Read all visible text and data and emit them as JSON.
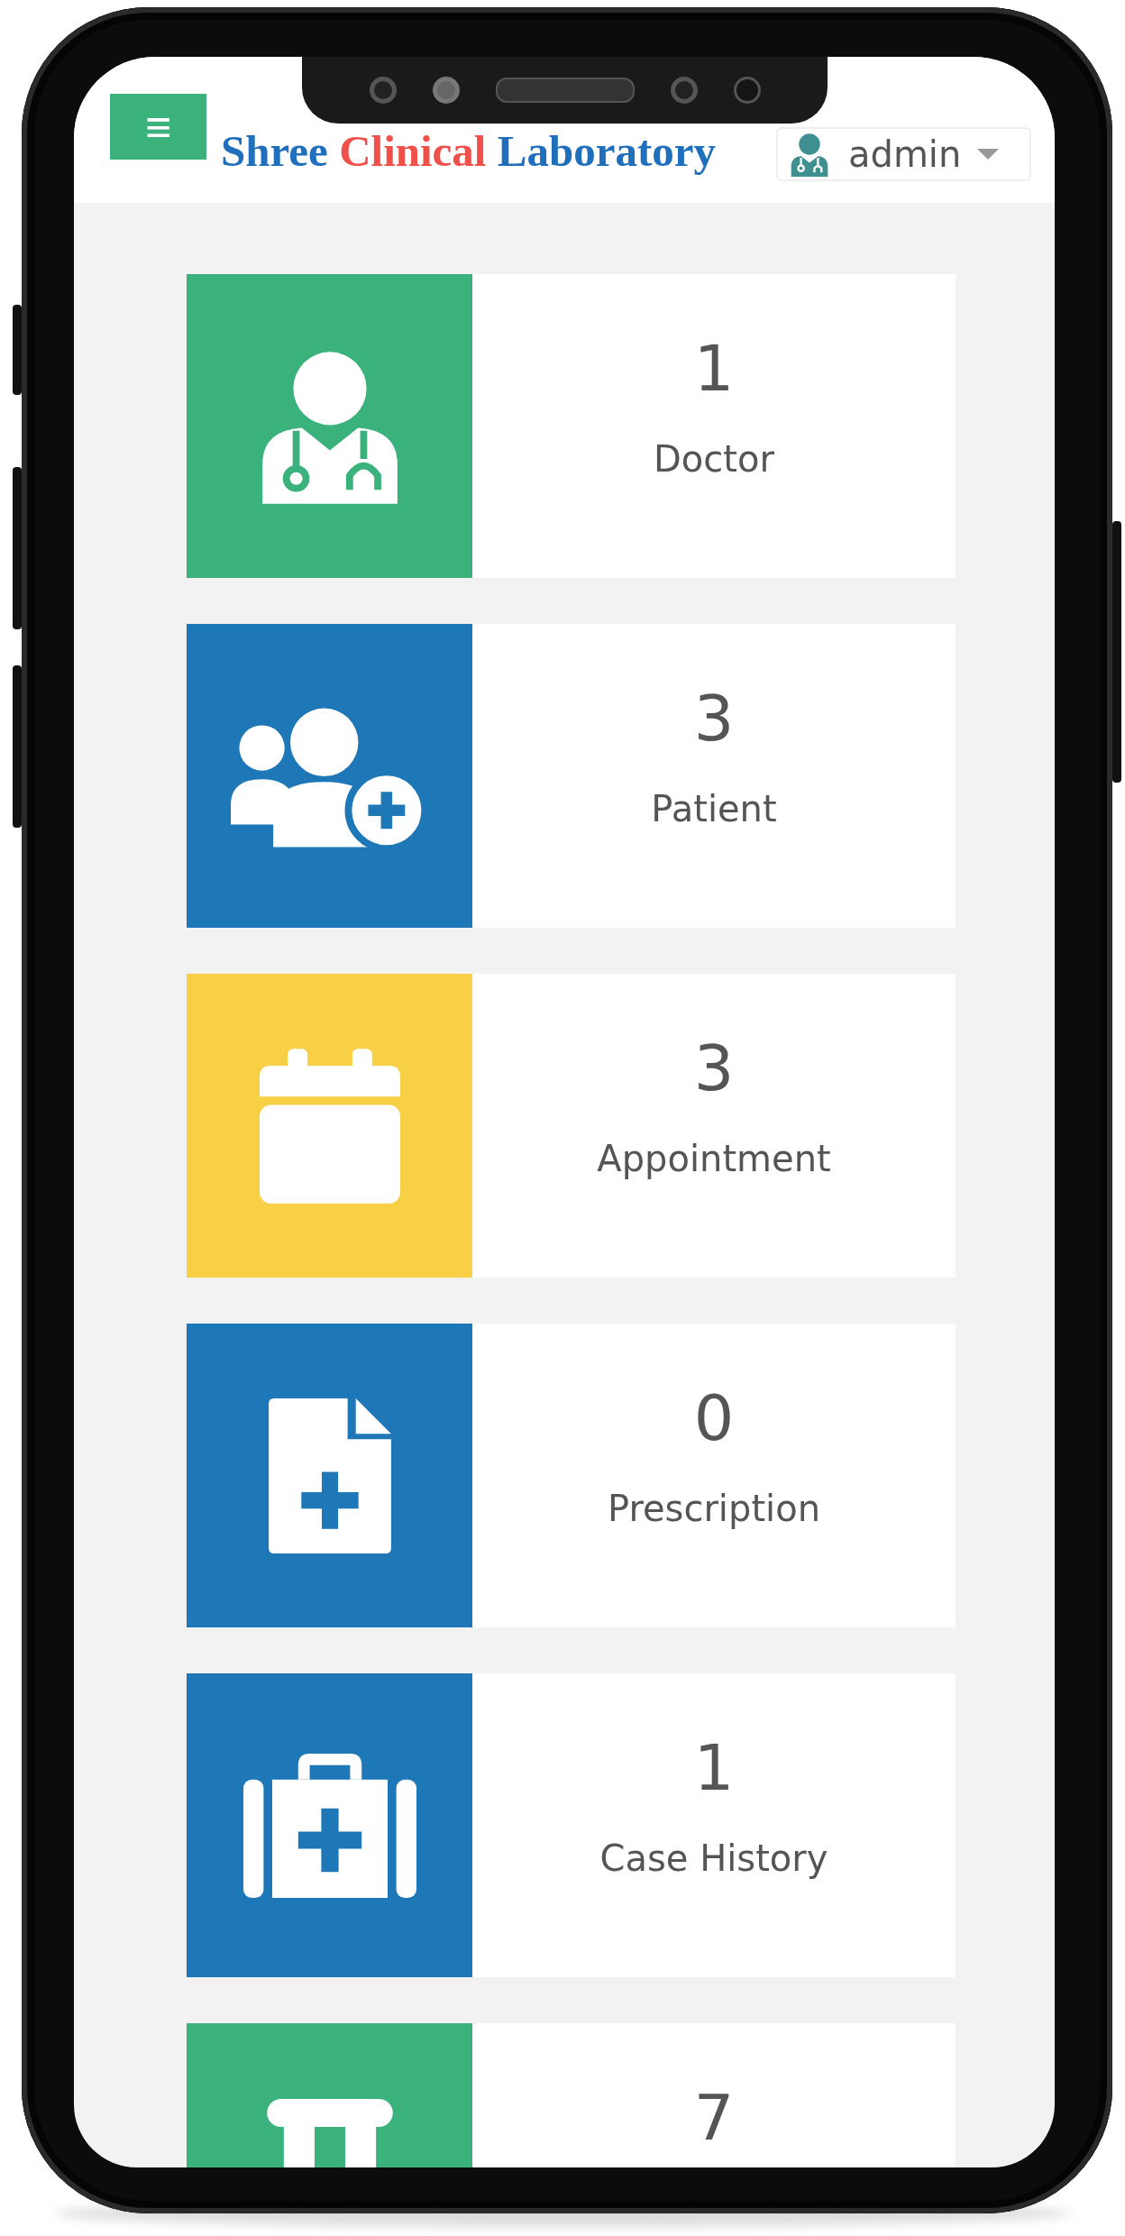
{
  "header": {
    "menu_icon": "≡",
    "title": [
      {
        "text": "Shree",
        "color": "#1f6fbd"
      },
      {
        "text": "Clinical",
        "color": "#f0504a"
      },
      {
        "text": "Laboratory",
        "color": "#1f6fbd"
      }
    ],
    "user": {
      "name": "admin"
    }
  },
  "cards": [
    {
      "count": "1",
      "label": "Doctor",
      "color": "#3bb27b",
      "kind": "doctor"
    },
    {
      "count": "3",
      "label": "Patient",
      "color": "#1e78b8",
      "kind": "patients"
    },
    {
      "count": "3",
      "label": "Appointment",
      "color": "#f7d046",
      "kind": "calendar"
    },
    {
      "count": "0",
      "label": "Prescription",
      "color": "#1e78b8",
      "kind": "file"
    },
    {
      "count": "1",
      "label": "Case History",
      "color": "#1e78b8",
      "kind": "medkit"
    },
    {
      "count": "7",
      "color": "#3bb27b",
      "kind": "pillar"
    }
  ]
}
